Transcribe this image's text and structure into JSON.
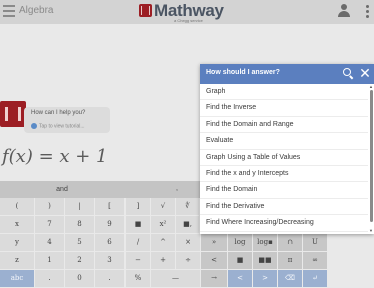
{
  "header": {
    "subject": "Algebra",
    "logo_text": "Mathway",
    "logo_sub": "a Chegg service",
    "icons": [
      "menu-icon",
      "user-icon",
      "more-vert-icon"
    ]
  },
  "chat": {
    "message": "How can I help you?",
    "tutorial": "Tap to view tutorial..."
  },
  "expression": "f(x) = x + 1",
  "tabs": {
    "first": "and",
    "second": ","
  },
  "keypad": {
    "rows": [
      [
        "(",
        ")",
        "|",
        "[",
        "]",
        "√",
        "∜",
        "■"
      ],
      [
        "x",
        "7",
        "8",
        "9",
        "■",
        "x²",
        "■,"
      ],
      [
        "y",
        "4",
        "5",
        "6",
        "/",
        "^",
        "×",
        "»",
        "log",
        "log▪",
        "∩",
        "U"
      ],
      [
        "z",
        "1",
        "2",
        "3",
        "−",
        "+",
        "÷",
        "<",
        "■",
        "■■",
        "π",
        "∞"
      ],
      [
        "abc",
        ".",
        "0",
        ".",
        "%",
        "—",
        "→",
        "<",
        ">",
        "⌫",
        "↵"
      ]
    ]
  },
  "popup": {
    "title": "How should I answer?",
    "options": [
      "Graph",
      "Find the Inverse",
      "Find the Domain and Range",
      "Evaluate",
      "Graph Using a Table of Values",
      "Find the x and y Intercepts",
      "Find the Domain",
      "Find the Derivative",
      "Find Where Increasing/Decreasing"
    ],
    "accent_color": "#5b7fbf"
  },
  "colors": {
    "brand": "#9c1e24",
    "header_bg": "#d3d3d3",
    "popup_header": "#5b7fbf"
  }
}
